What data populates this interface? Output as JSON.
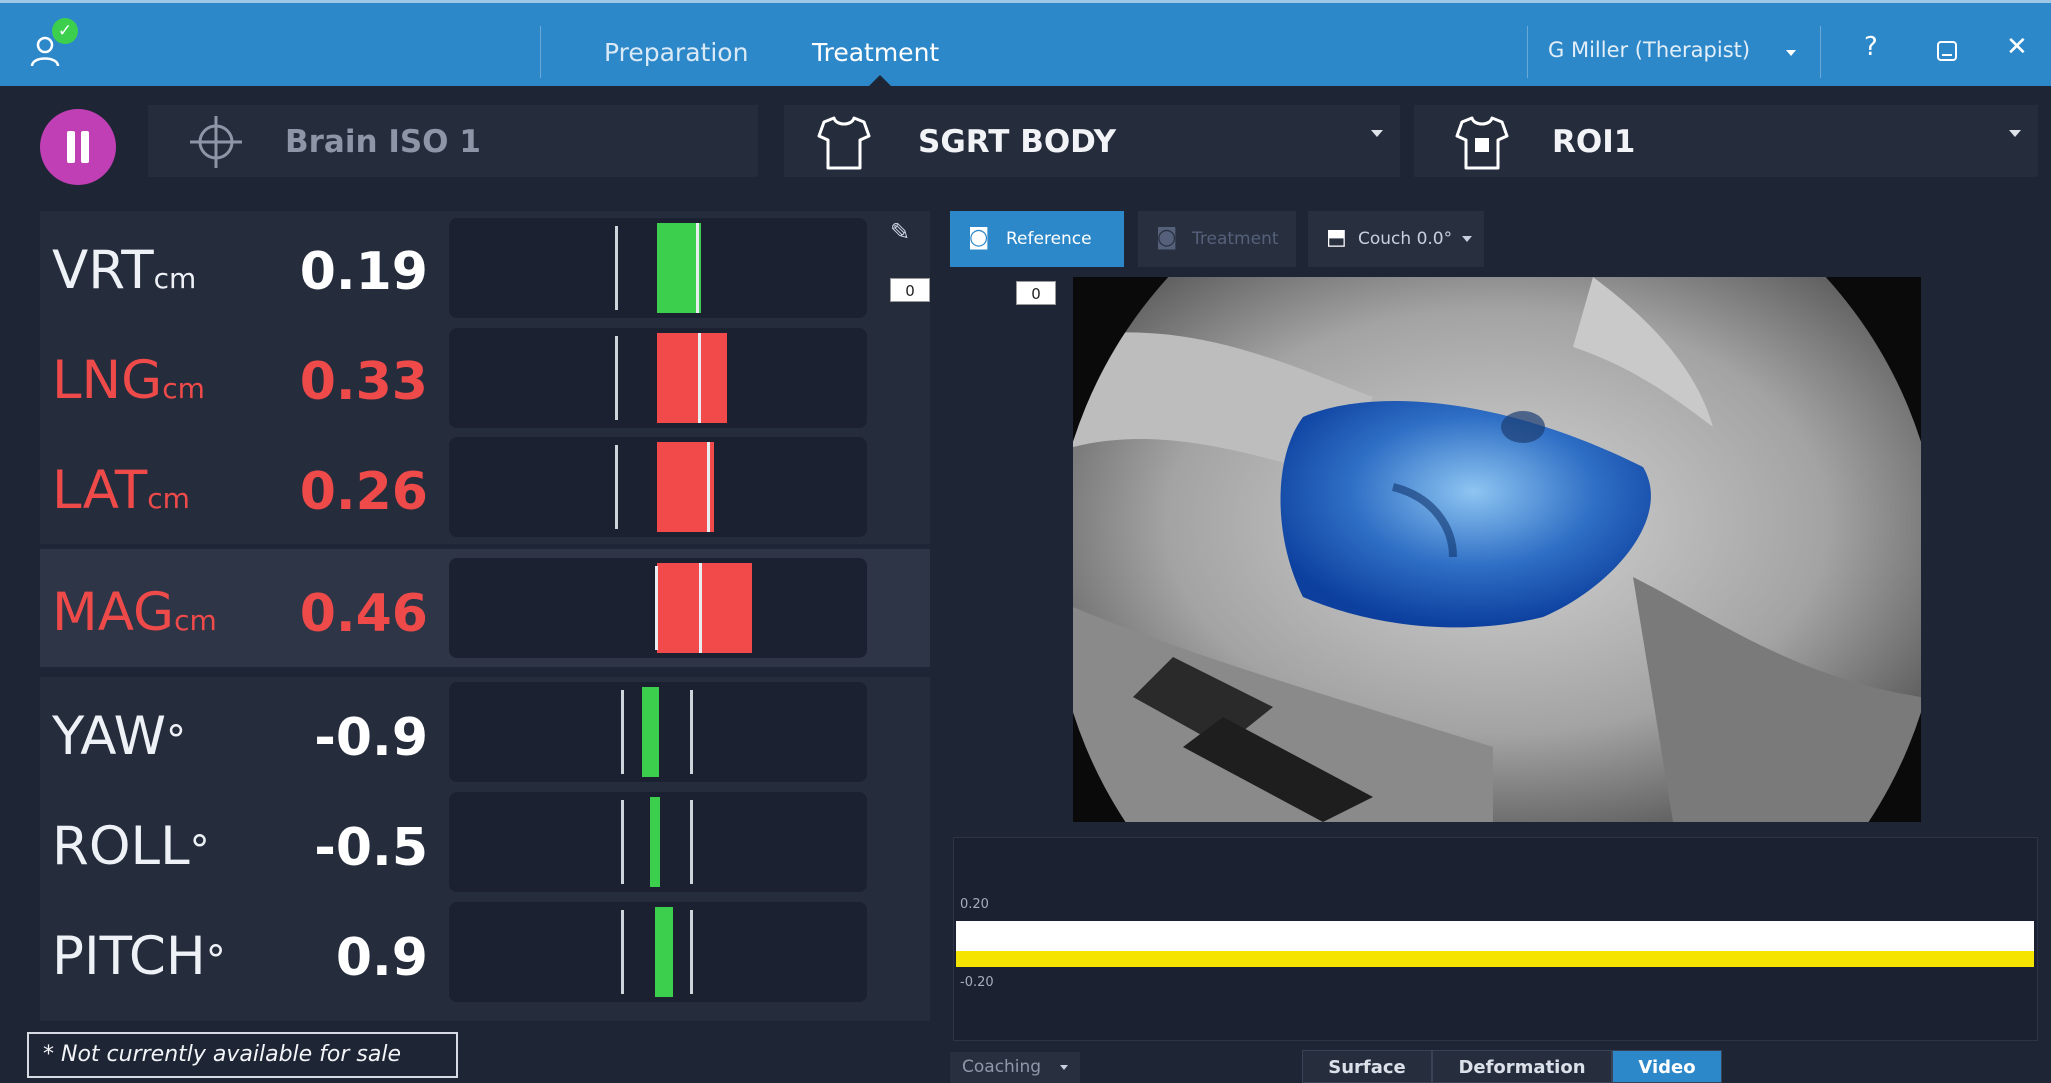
{
  "topbar": {
    "tabs": [
      {
        "label": "Preparation"
      },
      {
        "label": "Treatment"
      }
    ],
    "user_name": "G Miller (Therapist)",
    "help_label": "?",
    "close_label": "✕",
    "colors": {
      "bar": "#2d88c9"
    }
  },
  "toolbar": {
    "isocenter_label": "Brain ISO 1",
    "surface_select": "SGRT BODY",
    "roi_select": "ROI1"
  },
  "metrics": [
    {
      "label": "VRT",
      "unit": "cm",
      "value": "0.19",
      "status": "ok"
    },
    {
      "label": "LNG",
      "unit": "cm",
      "value": "0.33",
      "status": "alert"
    },
    {
      "label": "LAT",
      "unit": "cm",
      "value": "0.26",
      "status": "alert"
    },
    {
      "label": "MAG",
      "unit": "cm",
      "value": "0.46",
      "status": "alert"
    },
    {
      "label": "YAW",
      "unit": "°",
      "value": "-0.9",
      "status": "ok"
    },
    {
      "label": "ROLL",
      "unit": "°",
      "value": "-0.5",
      "status": "ok"
    },
    {
      "label": "PITCH",
      "unit": "°",
      "value": "0.9",
      "status": "ok"
    }
  ],
  "colors": {
    "ok": "#3ccf4e",
    "alert": "#f24a4a",
    "accent": "#2d88c9",
    "pause": "#c03fb5"
  },
  "offset_boxes": [
    "0",
    "0"
  ],
  "camera": {
    "reference_label": "Reference",
    "treatment_label": "Treatment",
    "couch_label": "Couch 0.0°"
  },
  "plot": {
    "upper_label": "0.20",
    "lower_label": "-0.20"
  },
  "bottom": {
    "coaching_label": "Coaching",
    "views": [
      {
        "label": "Surface",
        "active": false
      },
      {
        "label": "Deformation",
        "active": false
      },
      {
        "label": "Video",
        "active": true
      }
    ]
  },
  "disclaimer": "* Not currently available for sale"
}
